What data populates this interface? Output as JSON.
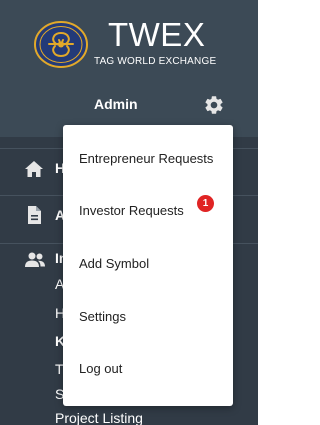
{
  "brand": {
    "name": "TWEX",
    "subtitle": "TAG WORLD EXCHANGE"
  },
  "header": {
    "user_label": "Admin",
    "settings_icon": "gear-icon"
  },
  "sidebar": {
    "items": [
      {
        "label": "H",
        "icon": "home-icon"
      },
      {
        "label": "A",
        "icon": "file-icon"
      },
      {
        "label": "In",
        "icon": "users-icon"
      }
    ],
    "sub_items": [
      {
        "label": "A"
      },
      {
        "label": "H"
      },
      {
        "label": "K"
      },
      {
        "label": "T"
      },
      {
        "label": "S"
      },
      {
        "label": "Project Listing"
      }
    ]
  },
  "dropdown": {
    "items": [
      {
        "label": "Entrepreneur Requests"
      },
      {
        "label": "Investor Requests",
        "badge": "1"
      },
      {
        "label": "Add Symbol"
      },
      {
        "label": "Settings"
      },
      {
        "label": "Log out"
      }
    ]
  },
  "colors": {
    "sidebar_bg": "#313b46",
    "header_bg": "#3c4a56",
    "badge": "#e02424",
    "logo_gold": "#e2a92a",
    "logo_blue": "#233a78"
  }
}
